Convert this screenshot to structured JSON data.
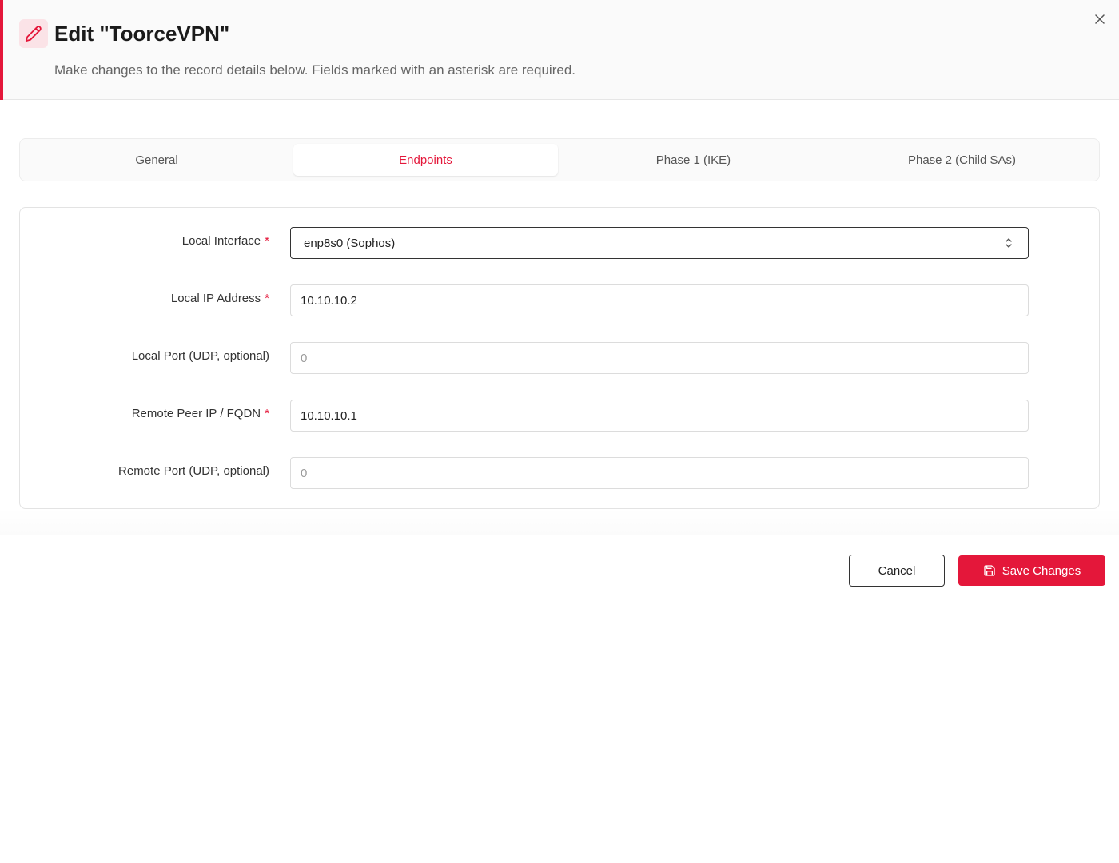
{
  "header": {
    "title": "Edit \"ToorceVPN\"",
    "subtitle": "Make changes to the record details below. Fields marked with an asterisk are required.",
    "accent_color": "#e4173a"
  },
  "tabs": [
    {
      "label": "General",
      "active": false
    },
    {
      "label": "Endpoints",
      "active": true
    },
    {
      "label": "Phase 1 (IKE)",
      "active": false
    },
    {
      "label": "Phase 2 (Child SAs)",
      "active": false
    }
  ],
  "form": {
    "local_interface": {
      "label": "Local Interface",
      "required": "*",
      "value": "enp8s0 (Sophos)"
    },
    "local_ip": {
      "label": "Local IP Address",
      "required": "*",
      "value": "10.10.10.2",
      "placeholder": ""
    },
    "local_port": {
      "label": "Local Port (UDP, optional)",
      "value": "",
      "placeholder": "0"
    },
    "remote_peer": {
      "label": "Remote Peer IP / FQDN",
      "required": "*",
      "value": "10.10.10.1",
      "placeholder": ""
    },
    "remote_port": {
      "label": "Remote Port (UDP, optional)",
      "value": "",
      "placeholder": "0"
    }
  },
  "footer": {
    "cancel_label": "Cancel",
    "save_label": "Save Changes"
  },
  "icons": {
    "edit": "pencil-icon",
    "close": "close-icon",
    "select": "chevron-up-down-icon",
    "save": "floppy-disk-icon"
  }
}
